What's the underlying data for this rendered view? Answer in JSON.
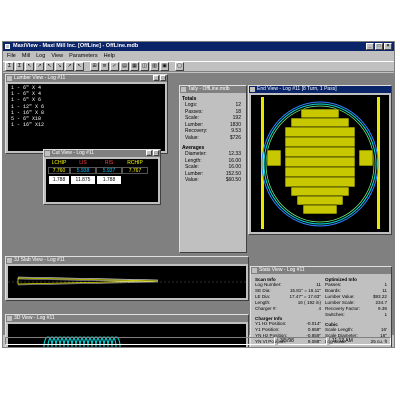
{
  "app": {
    "title": "MaxiView - Maxi Mill Inc. [OffLine] - OffLine.mdb",
    "window_buttons": [
      "_",
      "□",
      "×"
    ]
  },
  "menu": [
    "File",
    "Mill",
    "Log",
    "View",
    "Parameters",
    "Help"
  ],
  "toolbar": [
    "Σ",
    "Σ",
    "↖",
    "↗",
    "↖",
    "↘",
    "↗",
    "↖",
    "⊞",
    "≡",
    "✓",
    "▤",
    "▦",
    "◫",
    "▥",
    "▣",
    "▢"
  ],
  "lumber_view": {
    "title": "Lumber View - Log #11",
    "items": [
      "1 -  6\" X 4",
      "1 -  6\" X 4",
      "1 -  6\" X 6",
      "1 - 12\" X 6",
      "1 - 16\" X 8",
      "5 -  6\" X10",
      "1 - 16\" X12"
    ]
  },
  "cut_view": {
    "title": "Cut View - Log #11",
    "headers": [
      "LCHIP",
      "LIS",
      "RIS",
      "RCHIP"
    ],
    "boxes": [
      "7.760",
      "5.938",
      "5.937",
      "7.767"
    ],
    "values": [
      "1.788",
      "11.875",
      "1.788",
      ""
    ]
  },
  "tally": {
    "title": "Tally - OffLine.mdb",
    "totals_label": "Totals",
    "totals": [
      {
        "label": "Logs:",
        "value": "12"
      },
      {
        "label": "Passes:",
        "value": "18"
      },
      {
        "label": "Scale:",
        "value": "192"
      },
      {
        "label": "Lumber:",
        "value": "1830"
      },
      {
        "label": "Recovery:",
        "value": "9.53"
      },
      {
        "label": "Value:",
        "value": "$726"
      }
    ],
    "averages_label": "Averages",
    "averages": [
      {
        "label": "Diameter:",
        "value": "12.33"
      },
      {
        "label": "Length:",
        "value": "16.00"
      },
      {
        "label": "Scale:",
        "value": "16.00"
      },
      {
        "label": "Lumber:",
        "value": "152.50"
      },
      {
        "label": "Value:",
        "value": "$60.50"
      }
    ]
  },
  "end_view": {
    "title": "End View - Log #11 [8 Turn, 1 Pass]"
  },
  "slab_view": {
    "title": "3J Slab View - Log #11"
  },
  "view3d": {
    "title": "3D View - Log #11"
  },
  "stats": {
    "title": "Stats View - Log #11",
    "scan_title": "Scan Info",
    "scan": [
      {
        "label": "Log Number:",
        "value": "11"
      },
      {
        "label": "SE Dia:",
        "value": "15.81\" =  16.11\""
      },
      {
        "label": "LE Dia:",
        "value": "17.47\" =  17.63\""
      },
      {
        "label": "Length:",
        "value": "16     ( 192 in)"
      },
      {
        "label": "Charger #:",
        "value": "4"
      }
    ],
    "opt_title": "Optimized Info",
    "opt": [
      {
        "label": "Passes:",
        "value": "1"
      },
      {
        "label": "Boards:",
        "value": "11"
      },
      {
        "label": "Lumber Value:",
        "value": "$93.22"
      },
      {
        "label": "Lumber Scale:",
        "value": "234.7"
      },
      {
        "label": "Recovery Factor:",
        "value": "9.39"
      },
      {
        "label": "Switches:",
        "value": "1"
      }
    ],
    "charger_title": "Charger Info",
    "charger": [
      {
        "label": "Y1 Hz Position:",
        "value": "-0.014\""
      },
      {
        "label": "Y1 Position:",
        "value": "0.659\""
      },
      {
        "label": "YN Hz Position:",
        "value": "-0.659\""
      },
      {
        "label": "YN Vt Position:",
        "value": "9.088\""
      }
    ],
    "cubic_title": "Cubic",
    "cubic": [
      {
        "label": "Scale Length:",
        "value": "16'"
      },
      {
        "label": "Scale Diameter:",
        "value": "16\""
      },
      {
        "label": "Log Scale:",
        "value": "25 cu. ft"
      }
    ]
  },
  "status": {
    "text": "Status: OK",
    "date": "3/5/98",
    "time": "11:12 AM"
  },
  "colors": {
    "title_active": "#0a246a",
    "face": "#c0c0c0",
    "desktop": "#808080",
    "board_yellow": "#c8c800",
    "cyan": "#00e0e0",
    "slab_yellow": "#e8e800"
  }
}
